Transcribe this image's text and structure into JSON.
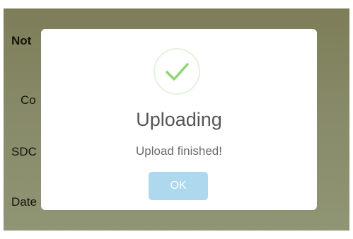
{
  "background": {
    "title": "Not",
    "field_1": "Co",
    "field_2": "SDC",
    "field_3": "Date"
  },
  "dialog": {
    "icon": "checkmark-icon",
    "title": "Uploading",
    "message": "Upload finished!",
    "ok_label": "OK",
    "accent_color": "#8fd476",
    "button_color": "#add8ee"
  }
}
